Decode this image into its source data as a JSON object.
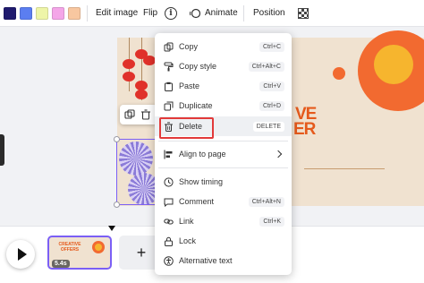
{
  "toolbar": {
    "colors": [
      "#1f1a6e",
      "#5b7ef0",
      "#eef5a8",
      "#f4a6e8",
      "#f8c7a0"
    ],
    "edit_image_label": "Edit image",
    "flip_label": "Flip",
    "info_label": "i",
    "animate_label": "Animate",
    "position_label": "Position",
    "transparency_icon": "checkerboard-icon"
  },
  "canvas": {
    "title_line1": "VE",
    "title_line2": "ER",
    "accent_color": "#e55a1c",
    "sun_color": "#f26a30",
    "sun_inner_color": "#f6b52e"
  },
  "context_menu": {
    "items": [
      {
        "label": "Copy",
        "shortcut": "Ctrl+C",
        "icon": "copy-icon"
      },
      {
        "label": "Copy style",
        "shortcut": "Ctrl+Alt+C",
        "icon": "paint-roller-icon"
      },
      {
        "label": "Paste",
        "shortcut": "Ctrl+V",
        "icon": "clipboard-icon"
      },
      {
        "label": "Duplicate",
        "shortcut": "Ctrl+D",
        "icon": "duplicate-icon"
      },
      {
        "label": "Delete",
        "shortcut": "DELETE",
        "icon": "trash-icon"
      },
      {
        "label": "Align to page",
        "icon": "align-icon"
      },
      {
        "label": "Show timing",
        "icon": "clock-icon"
      },
      {
        "label": "Comment",
        "shortcut": "Ctrl+Alt+N",
        "icon": "comment-icon"
      },
      {
        "label": "Link",
        "shortcut": "Ctrl+K",
        "icon": "link-icon"
      },
      {
        "label": "Lock",
        "icon": "lock-icon"
      },
      {
        "label": "Alternative text",
        "icon": "accessibility-icon"
      }
    ],
    "highlight_color": "#e23a3a"
  },
  "timeline": {
    "thumb_title": "CREATIVE OFFERS",
    "duration": "5.4s",
    "add_label": "+"
  }
}
